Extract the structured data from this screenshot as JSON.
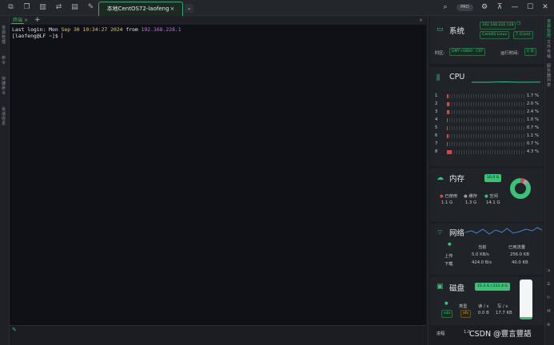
{
  "titlebar": {
    "toolbar_icons": [
      "new-window-icon",
      "document-icon",
      "columns-icon",
      "transfer-icon",
      "list-icon",
      "tool-icon"
    ],
    "active_tab": {
      "label": "本地CentOS72-laofeng",
      "close": "×"
    },
    "tab_dropdown": "⌄",
    "search_icon": "search-icon",
    "pro_badge": "PRO",
    "settings_icon": "gear-icon",
    "pin_icon": "pin-icon",
    "minimize": "—",
    "maximize": "☐",
    "close": "✕"
  },
  "left_sidebar": {
    "items": [
      "资源管理",
      "命令",
      "快捷命令",
      "会话信息"
    ]
  },
  "subtabs": {
    "label": "终端",
    "close": "×",
    "add": "+",
    "close_all": "×"
  },
  "terminal": {
    "login_prefix": "Last login: ",
    "login_day": "Mon ",
    "login_date": "Sep 30 10:34:27 2024",
    "login_from": " from ",
    "login_ip": "192.168.228.1",
    "prompt": "[laofeng@LF ~]$ "
  },
  "term_status_icon": "pencil-icon",
  "system": {
    "title": "系统",
    "ip": "192.168.220.128",
    "os_badge": "CentOS Linux",
    "version_badge": "7 (Core)",
    "timezone_label": "时区:",
    "timezone_value": "GMT+0800 · CST",
    "uptime_label": "运行时间:",
    "uptime_value": "0 天"
  },
  "cpu": {
    "title": "CPU",
    "cores": [
      {
        "n": "1",
        "pct": 1.7,
        "label": "1.7 %"
      },
      {
        "n": "2",
        "pct": 2.0,
        "label": "2.0 %"
      },
      {
        "n": "3",
        "pct": 2.4,
        "label": "2.4 %"
      },
      {
        "n": "4",
        "pct": 1.0,
        "label": "1.0 %"
      },
      {
        "n": "5",
        "pct": 0.7,
        "label": "0.7 %"
      },
      {
        "n": "6",
        "pct": 1.1,
        "label": "1.1 %"
      },
      {
        "n": "7",
        "pct": 0.7,
        "label": "0.7 %"
      },
      {
        "n": "8",
        "pct": 4.3,
        "label": "4.3 %"
      }
    ]
  },
  "memory": {
    "title": "内存",
    "total_badge": "16.4 G",
    "used_label": "已使用",
    "used_value": "1.1 G",
    "cache_label": "缓存",
    "cache_value": "1.3 G",
    "free_label": "空闲",
    "free_value": "14.1 G",
    "used_fraction": 0.07,
    "cache_fraction": 0.08
  },
  "network": {
    "title": "网络",
    "col_current": "当前",
    "col_total": "已用流量",
    "up_label": "上传",
    "up_current": "5.0 KB/s",
    "up_total": "256.0 KB",
    "down_label": "下载",
    "down_current": "424.0 B/s",
    "down_total": "40.0 KB"
  },
  "disk": {
    "title": "磁盘",
    "usage_badge": "15.3 G / 211.4 G",
    "col_type": "类型",
    "col_read": "读 / s",
    "col_write": "写 / s",
    "device": "sda",
    "type": "xfs",
    "read": "0.0 B",
    "write": "17.7 KB",
    "used_fraction": 0.07
  },
  "process": {
    "label": "进程",
    "partial": "1.0"
  },
  "right_sidebar": {
    "items": [
      "资源监控",
      "文件传输",
      "服务器列表"
    ]
  },
  "watermark": "CSDN @豐言豐語",
  "colors": {
    "accent": "#3cc178",
    "cpu_bar": "#d04a4a",
    "terminal_bg": "#0f1117"
  }
}
